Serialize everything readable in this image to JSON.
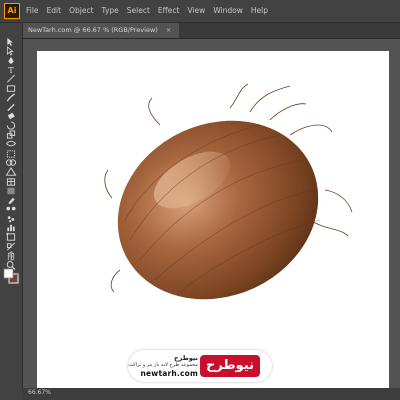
{
  "app": {
    "logo": "Ai"
  },
  "menu": [
    "File",
    "Edit",
    "Object",
    "Type",
    "Select",
    "Effect",
    "View",
    "Window",
    "Help"
  ],
  "document": {
    "tab_title": "NewTarh.com @ 66.67 % (RGB/Preview)",
    "close_glyph": "×"
  },
  "status": {
    "zoom": "66.67%"
  },
  "colors": {
    "fill": "#ffffff",
    "stroke": "#ff0000",
    "canvas": "#535353",
    "artboard": "#ffffff"
  },
  "watermark": {
    "logo_text": "نیوطرح",
    "title": "نیوطرح",
    "subtitle": "مجموعه طرح لایه باز بنر و تراکت",
    "url": "newtarh.com"
  },
  "tools": [
    "selection-tool",
    "direct-selection-tool",
    "pen-tool",
    "type-tool",
    "line-tool",
    "rectangle-tool",
    "paintbrush-tool",
    "pencil-tool",
    "eraser-tool",
    "rotate-tool",
    "scale-tool",
    "width-tool",
    "free-transform-tool",
    "shape-builder-tool",
    "perspective-grid-tool",
    "mesh-tool",
    "gradient-tool",
    "eyedropper-tool",
    "blend-tool",
    "symbol-sprayer-tool",
    "graph-tool",
    "artboard-tool",
    "slice-tool",
    "hand-tool",
    "zoom-tool"
  ]
}
